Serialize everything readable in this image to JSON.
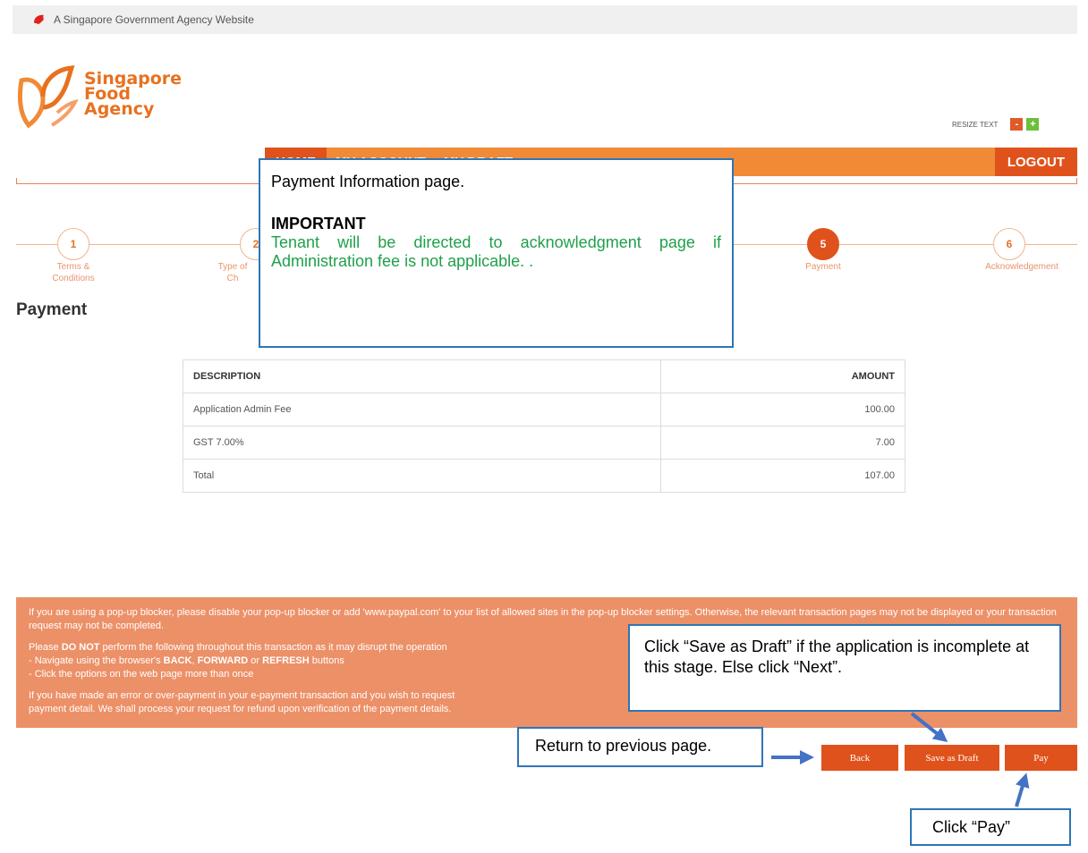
{
  "gov_banner": {
    "text": "A Singapore Government Agency Website"
  },
  "logo": {
    "line1": "Singapore",
    "line2": "Food",
    "line3": "Agency"
  },
  "resize": {
    "label": "RESIZE TEXT",
    "decrease": "-",
    "increase": "+"
  },
  "nav": {
    "home": "HOME",
    "my_account": "MY ACCOUNT",
    "my_draft": "MY DRAFT",
    "logout": "LOGOUT"
  },
  "steps": [
    {
      "number": "1",
      "label": "Terms &\nConditions"
    },
    {
      "number": "2",
      "label": "Type of\nCh"
    },
    {
      "number": "5",
      "label": "Payment"
    },
    {
      "number": "6",
      "label": "Acknowledgement"
    }
  ],
  "section_title": "Payment",
  "callout_main": {
    "title": "Payment Information page.",
    "important": "IMPORTANT",
    "body": "Tenant will be directed to acknowledgment page if Administration fee is not applicable. ."
  },
  "table": {
    "headers": {
      "description": "DESCRIPTION",
      "amount": "AMOUNT"
    },
    "rows": [
      {
        "description": "Application Admin Fee",
        "amount": "100.00"
      },
      {
        "description": "GST 7.00%",
        "amount": "7.00"
      },
      {
        "description": "Total",
        "amount": "107.00"
      }
    ]
  },
  "notice": {
    "p1": "If you are using a pop-up blocker, please disable your pop-up blocker or add 'www.paypal.com' to your list of allowed sites in the pop-up blocker settings. Otherwise, the relevant transaction pages may not be displayed or your transaction request may not be completed.",
    "p2_pre": "Please ",
    "p2_bold": "DO NOT",
    "p2_post": " perform the following throughout this transaction as it may disrupt the operation",
    "p2_line2_pre": "- Navigate using the browser's ",
    "p2_back": "BACK",
    "p2_sep": ", ",
    "p2_forward": "FORWARD",
    "p2_or": " or ",
    "p2_refresh": "REFRESH",
    "p2_buttons": " buttons",
    "p2_line3": "- Click the options on the web page more than once",
    "p3": "If you have made an error or over-payment in your e-payment transaction and you wish to request",
    "p3_line2": "payment detail. We shall process your request for refund upon verification of the payment details."
  },
  "callout_draft": {
    "text": "Click “Save as Draft” if the application is incomplete at this stage. Else click “Next”."
  },
  "callout_back": {
    "text": "Return to previous page."
  },
  "callout_pay": {
    "text": "Click “Pay”"
  },
  "buttons": {
    "back": "Back",
    "save_draft": "Save as Draft",
    "pay": "Pay"
  },
  "colors": {
    "primary": "#e0521c",
    "nav": "#f08a36",
    "notice": "#ec9068",
    "callout_border": "#2e75b6",
    "important_text": "#1fa04a"
  }
}
